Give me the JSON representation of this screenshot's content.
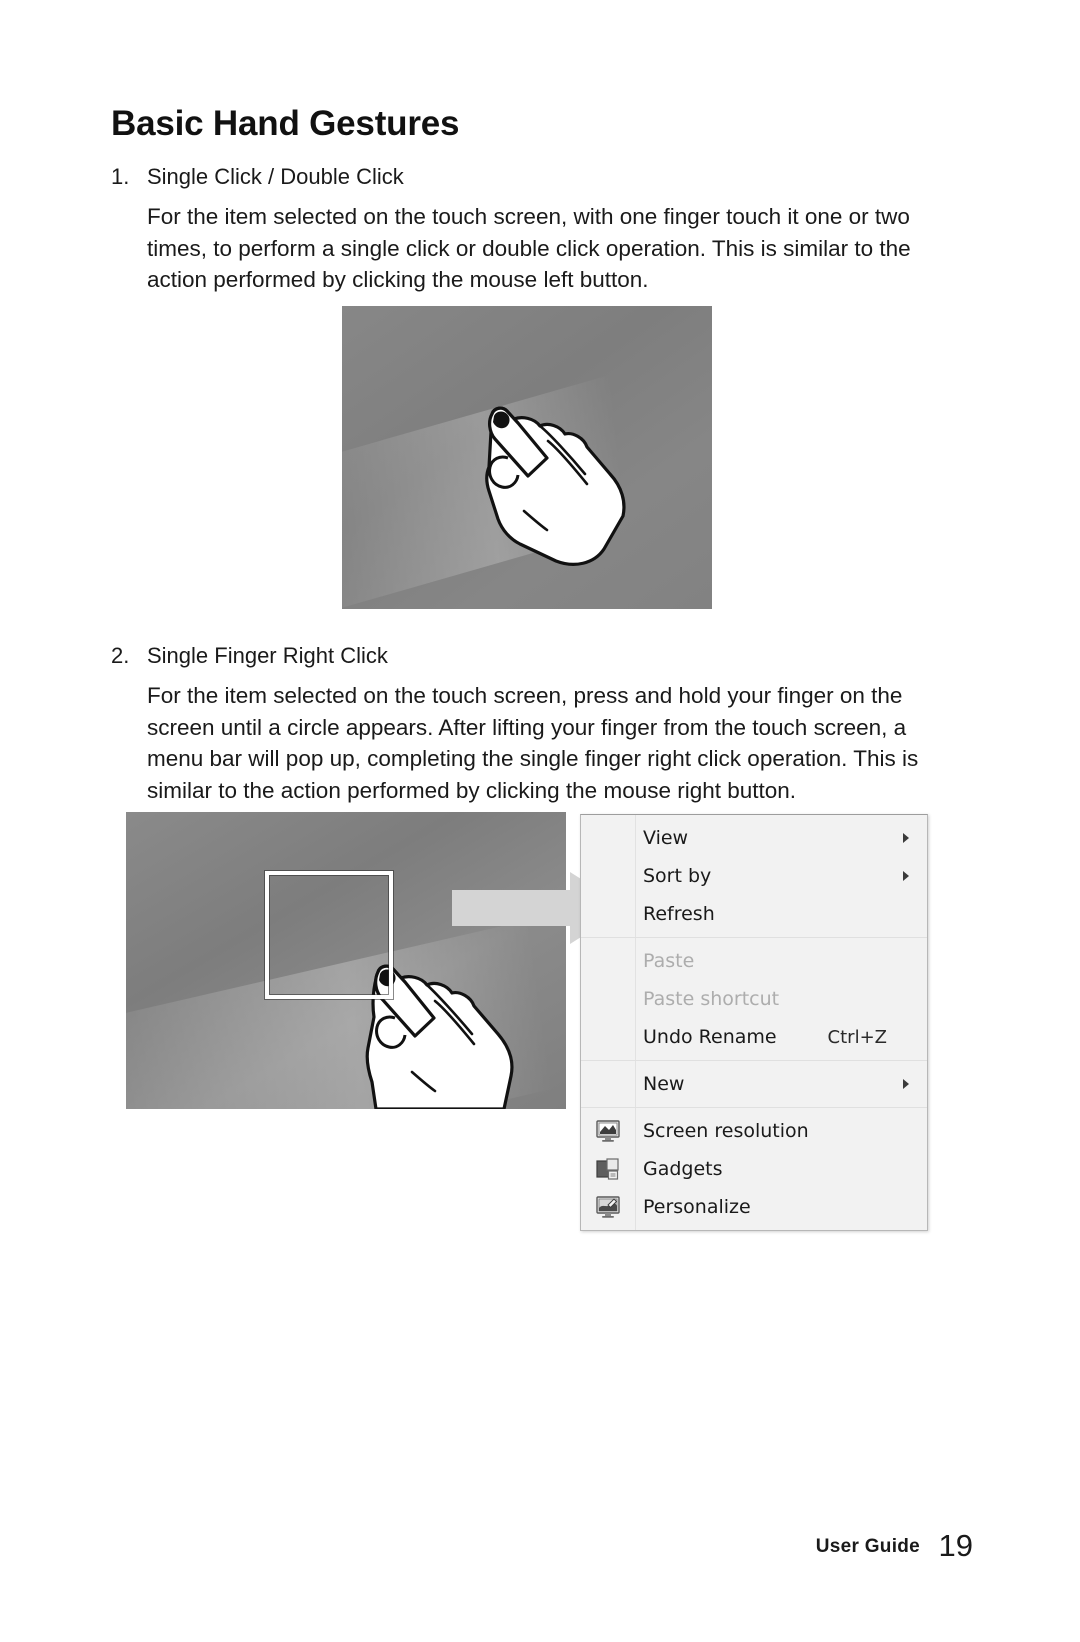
{
  "document": {
    "title": "Basic Hand Gestures"
  },
  "sections": [
    {
      "number": "1.",
      "title": "Single Click / Double Click",
      "body": "For the item selected on the touch screen, with one finger touch it one or two times, to perform a single click or double click operation. This is similar to the action performed by clicking the mouse left button."
    },
    {
      "number": "2.",
      "title": "Single Finger Right Click",
      "body": "For the item selected on the touch screen, press and hold your finger on the screen until a circle appears. After lifting your finger from the touch screen, a menu bar will pop up, completing the single finger right click operation. This is similar to the action performed by clicking the mouse right button."
    }
  ],
  "figures": {
    "single_click": {
      "alt": "hand-pointing-one-finger-illustration"
    },
    "right_click": {
      "alt": "hand-pressing-selected-square-illustration"
    }
  },
  "context_menu": {
    "groups": [
      {
        "items": [
          {
            "label": "View",
            "submenu": true,
            "disabled": false,
            "accel": "",
            "icon": ""
          },
          {
            "label": "Sort by",
            "submenu": true,
            "disabled": false,
            "accel": "",
            "icon": ""
          },
          {
            "label": "Refresh",
            "submenu": false,
            "disabled": false,
            "accel": "",
            "icon": ""
          }
        ]
      },
      {
        "items": [
          {
            "label": "Paste",
            "submenu": false,
            "disabled": true,
            "accel": "",
            "icon": ""
          },
          {
            "label": "Paste shortcut",
            "submenu": false,
            "disabled": true,
            "accel": "",
            "icon": ""
          },
          {
            "label": "Undo Rename",
            "submenu": false,
            "disabled": false,
            "accel": "Ctrl+Z",
            "icon": ""
          }
        ]
      },
      {
        "items": [
          {
            "label": "New",
            "submenu": true,
            "disabled": false,
            "accel": "",
            "icon": ""
          }
        ]
      },
      {
        "items": [
          {
            "label": "Screen resolution",
            "submenu": false,
            "disabled": false,
            "accel": "",
            "icon": "monitor-icon"
          },
          {
            "label": "Gadgets",
            "submenu": false,
            "disabled": false,
            "accel": "",
            "icon": "gadgets-icon"
          },
          {
            "label": "Personalize",
            "submenu": false,
            "disabled": false,
            "accel": "",
            "icon": "personalize-icon"
          }
        ]
      }
    ]
  },
  "footer": {
    "label": "User Guide",
    "page": "19"
  },
  "colors": {
    "page_background": "#ffffff",
    "text": "#1a1a1a",
    "menu_background": "#f2f2f2",
    "menu_border": "#b7b7b7",
    "menu_disabled_text": "#adadad",
    "figure_gray": "#828282",
    "arrow_gray": "#d2d2d2"
  }
}
